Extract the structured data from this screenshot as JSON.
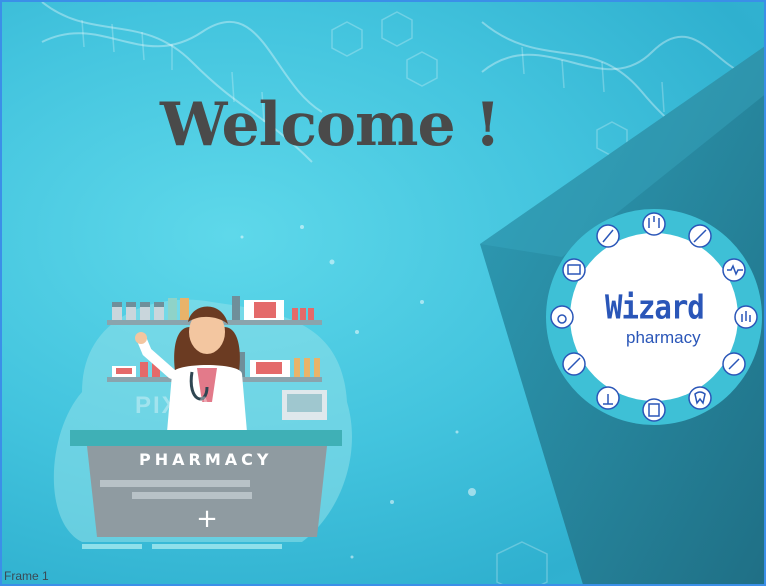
{
  "frame": {
    "label": "Frame 1"
  },
  "hero": {
    "title": "Welcome !"
  },
  "logo": {
    "line1": "Wizard",
    "line2": "pharmacy"
  },
  "illustration": {
    "counter_label": "PHARMACY",
    "watermark": "PIXTA"
  },
  "icons": [
    "lungs-icon",
    "syringe-icon",
    "heart-rate-icon",
    "hand-icon",
    "thermometer-icon",
    "tooth-icon",
    "pill-bottle-icon",
    "microscope-icon",
    "injection-icon",
    "stethoscope-icon",
    "medical-monitor-icon",
    "test-tube-icon"
  ],
  "colors": {
    "background": "#43c4de",
    "panel": "#2a8fa6",
    "title": "#4a4a4a",
    "logo_text": "#2a56b8",
    "logo_ring": "#3ec0d6"
  }
}
